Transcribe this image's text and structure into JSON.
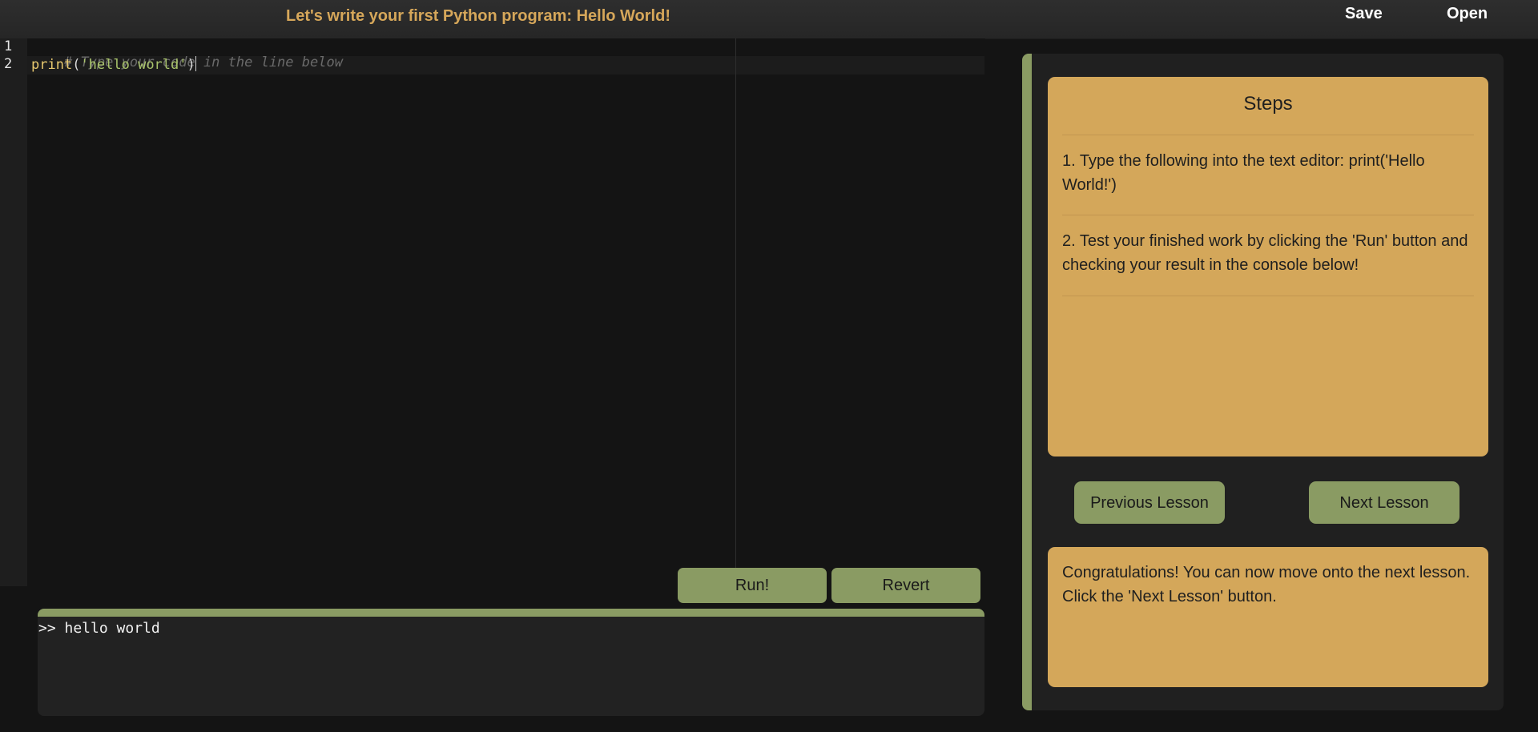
{
  "header": {
    "title": "Let's write your first Python program: Hello World!",
    "save_label": "Save",
    "open_label": "Open"
  },
  "editor": {
    "line_numbers": [
      "1",
      "2"
    ],
    "line1_comment": "# Type your code in the line below",
    "line2_fn": "print",
    "line2_open": "(",
    "line2_string": "'hello world'",
    "line2_close": ")"
  },
  "actions": {
    "run_label": "Run!",
    "revert_label": "Revert"
  },
  "console": {
    "output": ">> hello world"
  },
  "steps": {
    "title": "Steps",
    "items": [
      "1. Type the following into the text editor: print('Hello World!')",
      "2. Test your finished work by clicking the 'Run' button and checking your result in the console below!"
    ]
  },
  "nav": {
    "previous_label": "Previous Lesson",
    "next_label": "Next Lesson"
  },
  "feedback": {
    "message": "Congratulations! You can now move onto the next lesson. Click the 'Next Lesson' button."
  },
  "colors": {
    "accent_green": "#8a9b63",
    "card_tan": "#d4a75a",
    "title_orange": "#d6a75a",
    "background": "#141414"
  }
}
